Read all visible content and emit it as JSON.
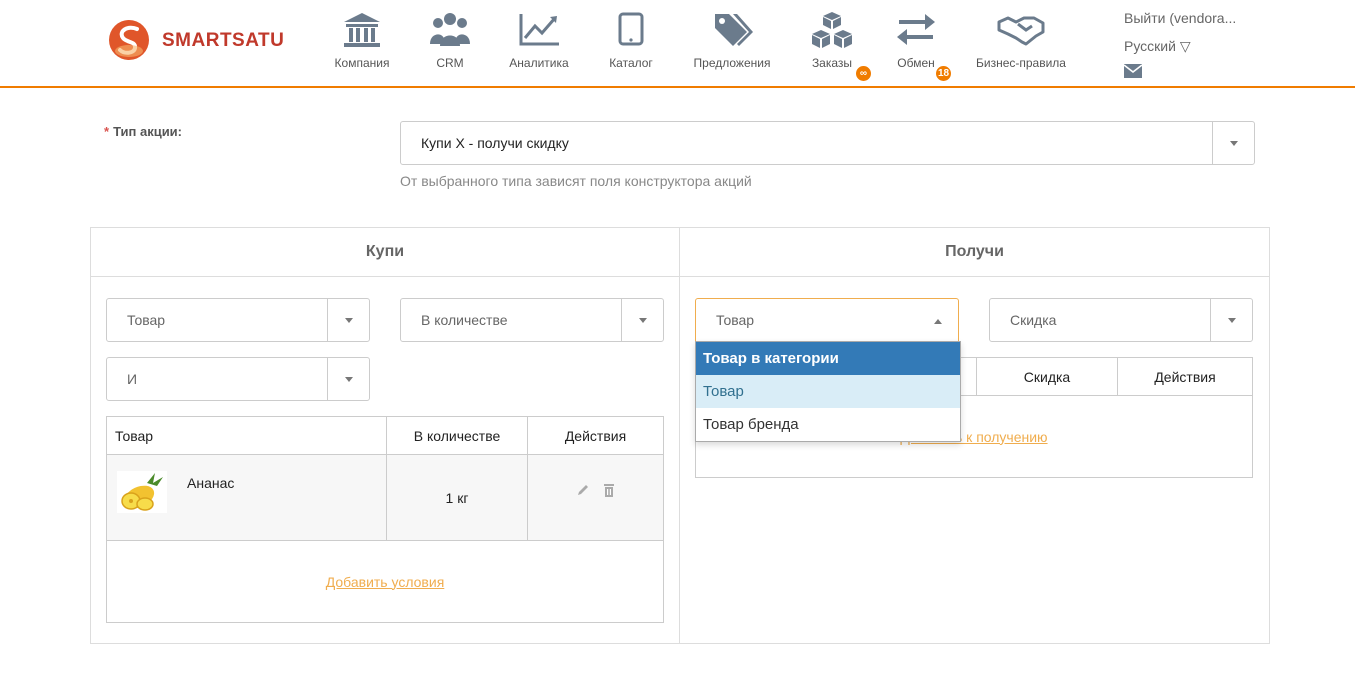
{
  "header": {
    "brand": "SMARTSATU",
    "nav": [
      {
        "icon": "bank-icon",
        "label": "Компания"
      },
      {
        "icon": "users-icon",
        "label": "CRM"
      },
      {
        "icon": "line-chart-icon",
        "label": "Аналитика"
      },
      {
        "icon": "tablet-icon",
        "label": "Каталог"
      },
      {
        "icon": "tags-icon",
        "label": "Предложения"
      },
      {
        "icon": "cubes-icon",
        "label": "Заказы",
        "badge": "∞"
      },
      {
        "icon": "exchange-icon",
        "label": "Обмен",
        "badge": "18"
      },
      {
        "icon": "handshake-icon",
        "label": "Бизнес-правила"
      }
    ],
    "user": "Выйти (vendora...",
    "language": "Русский ▽",
    "mail_icon": "envelope-icon"
  },
  "form": {
    "promo_type_label": "Тип акции:",
    "required_mark": "*",
    "promo_type_value": "Купи X - получи скидку",
    "promo_type_hint": "От выбранного типа зависят поля конструктора акций"
  },
  "buy": {
    "title": "Купи",
    "select_item": "Товар",
    "select_quantity": "В количестве",
    "select_logic": "И",
    "table": {
      "headers": [
        "Товар",
        "В количестве",
        "Действия"
      ],
      "rows": [
        {
          "name": "Ананас",
          "quantity": "1 кг",
          "image": "pineapple-image"
        }
      ]
    },
    "add_link": "Добавить условия"
  },
  "get": {
    "title": "Получи",
    "select_item": "Товар",
    "select_discount": "Скидка",
    "table": {
      "headers": [
        "Скидка",
        "Действия"
      ]
    },
    "add_link": "Добавить к получению",
    "dropdown_options": [
      {
        "label": "Товар в категории",
        "state": "highlighted"
      },
      {
        "label": "Товар",
        "state": "selected"
      },
      {
        "label": "Товар бренда",
        "state": "normal"
      }
    ]
  },
  "colors": {
    "accent": "#f07c00",
    "brand_red": "#c0392b",
    "dropdown_highlight": "#337ab7",
    "link": "#f0ad4e"
  }
}
